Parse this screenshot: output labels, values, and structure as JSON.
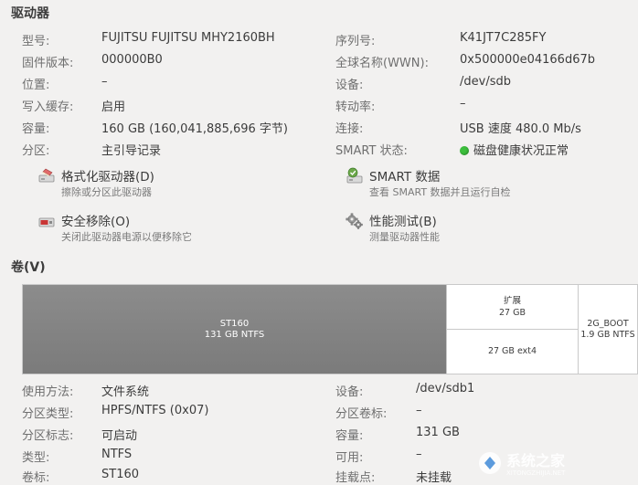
{
  "drive": {
    "title": "驱动器",
    "left": [
      {
        "label": "型号:",
        "value": "FUJITSU FUJITSU MHY2160BH"
      },
      {
        "label": "固件版本:",
        "value": "000000B0"
      },
      {
        "label": "位置:",
        "value": "–"
      },
      {
        "label": "写入缓存:",
        "value": "启用"
      },
      {
        "label": "容量:",
        "value": "160 GB (160,041,885,696 字节)"
      },
      {
        "label": "分区:",
        "value": "主引导记录"
      }
    ],
    "right": [
      {
        "label": "序列号:",
        "value": "K41JT7C285FY"
      },
      {
        "label": "全球名称(WWN):",
        "value": "0x500000e04166d67b"
      },
      {
        "label": "设备:",
        "value": "/dev/sdb"
      },
      {
        "label": "转动率:",
        "value": "–"
      },
      {
        "label": "连接:",
        "value": "USB 速度 480.0 Mb/s"
      },
      {
        "label": "SMART 状态:",
        "value": "磁盘健康状况正常"
      }
    ],
    "status_color": "#3cbf3c"
  },
  "actions": {
    "format": {
      "title": "格式化驱动器(D)",
      "sub": "擦除或分区此驱动器",
      "icon": "format-drive-icon"
    },
    "smart": {
      "title": "SMART 数据",
      "sub": "查看 SMART 数据并且运行自检",
      "icon": "smart-data-icon"
    },
    "remove": {
      "title": "安全移除(O)",
      "sub": "关闭此驱动器电源以便移除它",
      "icon": "safe-remove-icon"
    },
    "bench": {
      "title": "性能测试(B)",
      "sub": "测量驱动器性能",
      "icon": "benchmark-gears-icon"
    }
  },
  "volumes": {
    "title": "卷(V)",
    "main": {
      "name": "ST160",
      "detail": "131 GB NTFS"
    },
    "extended": {
      "name": "扩展",
      "size": "27 GB",
      "child": "27 GB ext4"
    },
    "boot": {
      "name": "2G_BOOT",
      "detail": "1.9 GB NTFS"
    },
    "left": [
      {
        "label": "使用方法:",
        "value": "文件系统"
      },
      {
        "label": "分区类型:",
        "value": "HPFS/NTFS (0x07)"
      },
      {
        "label": "分区标志:",
        "value": "可启动"
      },
      {
        "label": "类型:",
        "value": "NTFS"
      },
      {
        "label": "卷标:",
        "value": "ST160"
      }
    ],
    "right": [
      {
        "label": "设备:",
        "value": "/dev/sdb1"
      },
      {
        "label": "分区卷标:",
        "value": "–"
      },
      {
        "label": "容量:",
        "value": "131 GB"
      },
      {
        "label": "可用:",
        "value": "–"
      },
      {
        "label": "挂载点:",
        "value": "未挂载"
      }
    ]
  },
  "watermark": {
    "text": "系统之家",
    "url": "XITONGZHIJIA.NET"
  }
}
